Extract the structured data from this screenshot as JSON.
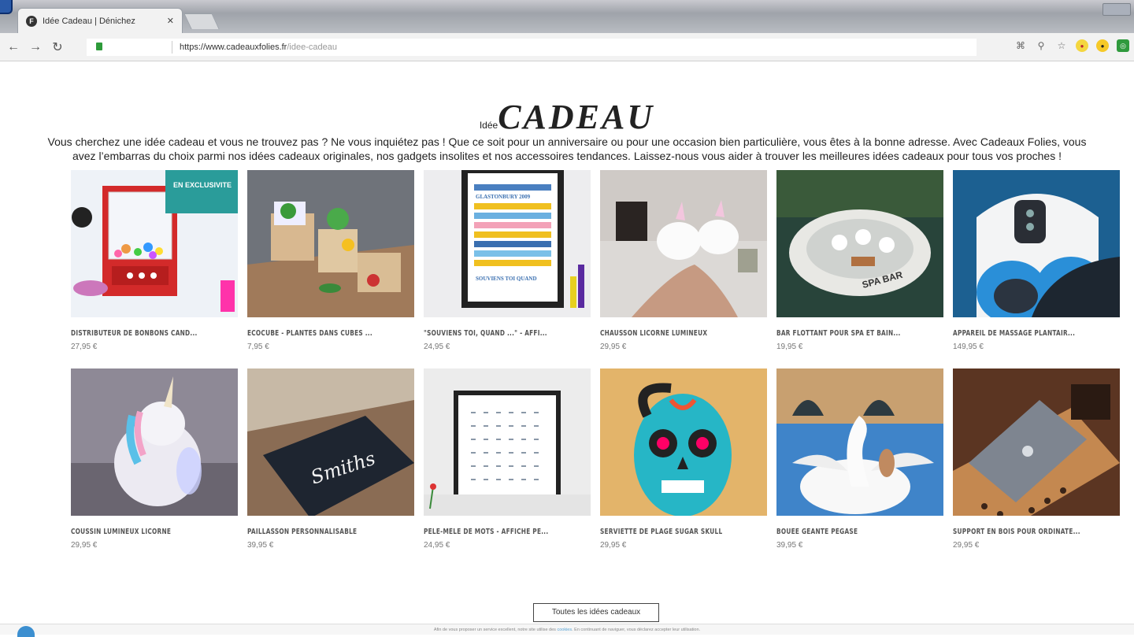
{
  "browser": {
    "tab_title": "Idée Cadeau | Dénichez",
    "tab_close": "✕",
    "favicon": "F",
    "url_host": "https://www.cadeauxfolies.fr",
    "url_path": "/idee-cadeau"
  },
  "page": {
    "heading_small": "Idée",
    "heading_big": "CADEAU",
    "intro": "Vous cherchez une idée cadeau et vous ne trouvez pas ? Ne vous inquiétez pas ! Que ce soit pour un anniversaire ou pour une occasion bien particulière, vous êtes à la bonne adresse. Avec Cadeaux Folies, vous avez l’embarras du choix parmi nos idées cadeaux originales, nos gadgets insolites et nos accessoires tendances. Laissez-nous vous aider à trouver les meilleures idées cadeaux pour tous vos proches !",
    "all_button": "Toutes les idées cadeaux",
    "cookie_text": "Afin de vous proposer un service excellent, notre site utilise des",
    "cookie_link": "cookies",
    "cookie_text2": ". En continuant de naviguer, vous déclarez accepter leur utilisation."
  },
  "products": [
    {
      "name": "DISTRIBUTEUR DE BONBONS CAND...",
      "price": "27,95 €"
    },
    {
      "name": "ECOCUBE - PLANTES DANS CUBES ...",
      "price": "7,95 €"
    },
    {
      "name": "\"SOUVIENS TOI, QUAND ...\" - AFFI...",
      "price": "24,95 €"
    },
    {
      "name": "CHAUSSON LICORNE LUMINEUX",
      "price": "29,95 €"
    },
    {
      "name": "BAR FLOTTANT POUR SPA ET BAIN...",
      "price": "19,95 €"
    },
    {
      "name": "APPAREIL DE MASSAGE PLANTAIR...",
      "price": "149,95 €"
    },
    {
      "name": "COUSSIN LUMINEUX LICORNE",
      "price": "29,95 €"
    },
    {
      "name": "PAILLASSON PERSONNALISABLE",
      "price": "39,95 €"
    },
    {
      "name": "PÊLE-MÊLE DE MOTS - AFFICHE PE...",
      "price": "24,95 €"
    },
    {
      "name": "SERVIETTE DE PLAGE SUGAR SKULL",
      "price": "29,95 €"
    },
    {
      "name": "BOUÉE GÉANTE PÉGASE",
      "price": "39,95 €"
    },
    {
      "name": "SUPPORT EN BOIS POUR ORDINATE...",
      "price": "29,95 €"
    }
  ],
  "thumb_text": {
    "claw_banner": "EN EXCLUSIVITE",
    "doormat": "Smiths",
    "float": "SPA BAR",
    "poster1": "SOUVIENS TOI QUAND",
    "poster2": "GLASTONBURY 2009"
  }
}
